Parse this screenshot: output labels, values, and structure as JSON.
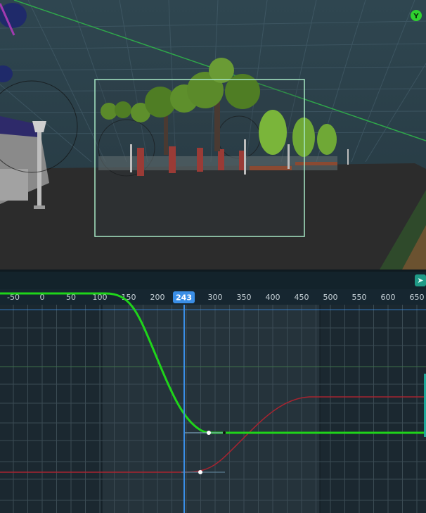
{
  "viewport": {
    "axis_gizmo_label": "Y",
    "colors": {
      "sky": "#2b3f48",
      "ground": "#2c2c2c",
      "camera_frame": "#a6e8c4",
      "x_axis": "#2fa84a"
    }
  },
  "toolbar": {
    "view_toggle_icon": "play-arrow-icon"
  },
  "ruler": {
    "ticks": [
      "-50",
      "0",
      "50",
      "100",
      "150",
      "200",
      "300",
      "350",
      "400",
      "450",
      "500",
      "550",
      "600",
      "650"
    ],
    "playhead_frame": "243"
  },
  "graph": {
    "colors": {
      "primary_curve": "#1fd41a",
      "secondary_curve": "#a82430",
      "playhead": "#3a8ee6",
      "active_range": "#25333b",
      "inactive_range": "#1b2830"
    }
  }
}
